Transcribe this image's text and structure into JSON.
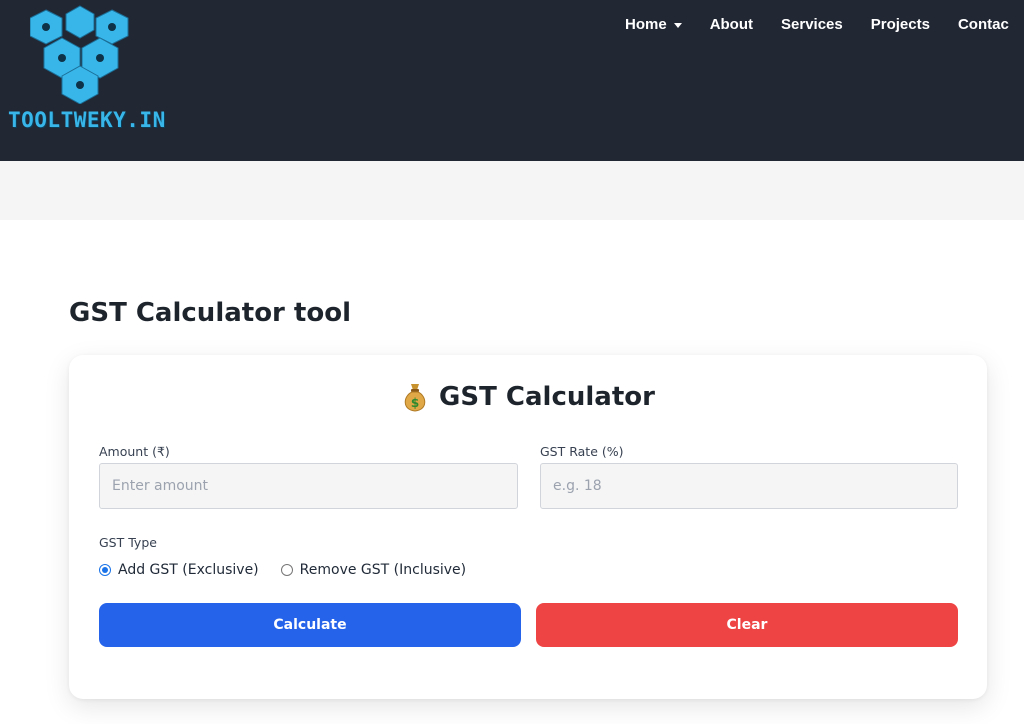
{
  "header": {
    "logo_text": "TOOLTWEKY.IN",
    "background_color": "#222734",
    "nav": [
      {
        "label": "Home",
        "has_dropdown": true
      },
      {
        "label": "About"
      },
      {
        "label": "Services"
      },
      {
        "label": "Projects"
      },
      {
        "label": "Contac"
      }
    ]
  },
  "page": {
    "title": "GST Calculator tool"
  },
  "calculator": {
    "title_icon": "money-bag-icon",
    "title": "GST Calculator",
    "amount": {
      "label": "Amount (₹)",
      "placeholder": "Enter amount",
      "value": ""
    },
    "rate": {
      "label": "GST Rate (%)",
      "placeholder": "e.g. 18",
      "value": ""
    },
    "type_label": "GST Type",
    "options": [
      {
        "label": "Add GST (Exclusive)",
        "checked": true
      },
      {
        "label": "Remove GST (Inclusive)",
        "checked": false
      }
    ],
    "calculate_label": "Calculate",
    "clear_label": "Clear",
    "calculate_color": "#2563eb",
    "clear_color": "#ef4444"
  }
}
